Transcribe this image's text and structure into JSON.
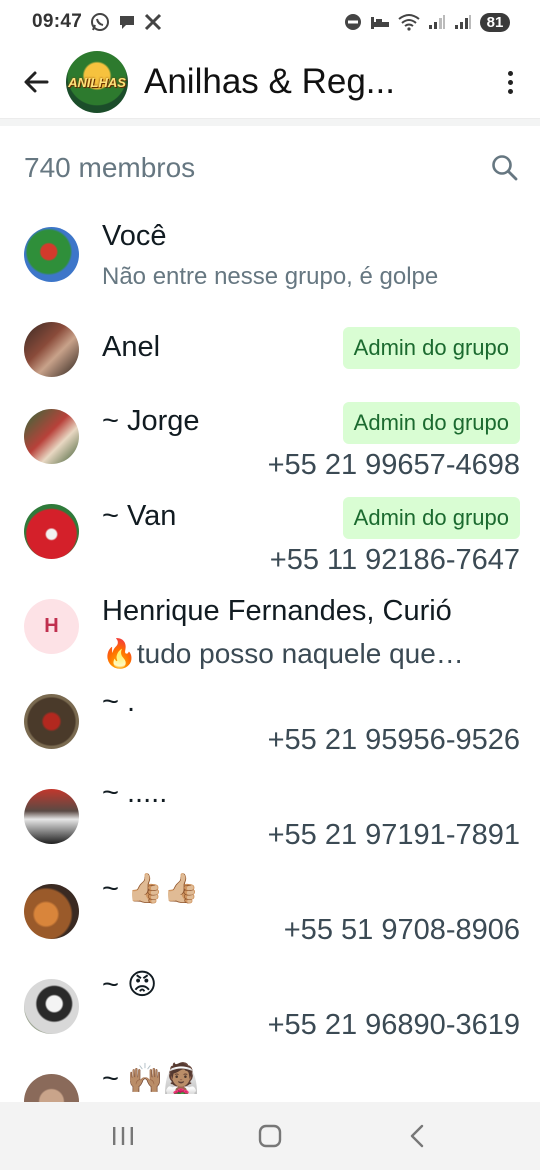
{
  "status_bar": {
    "time": "09:47",
    "battery": "81",
    "icons": [
      "whatsapp-icon",
      "chat-icon",
      "x-icon",
      "do-not-disturb-icon",
      "sleep-icon",
      "wifi-icon",
      "signal-icon",
      "signal-icon"
    ]
  },
  "header": {
    "title": "Anilhas & Reg...",
    "avatar_text": "ANILHAS",
    "icons": {
      "back": "arrow-back-icon",
      "menu": "more-vert-icon"
    }
  },
  "members": {
    "count_label": "740 membros",
    "search_icon": "search-icon",
    "admin_label": "Admin do grupo",
    "list": [
      {
        "name": "Você",
        "sub": "Não entre nesse grupo, é golpe",
        "phone": "",
        "admin": false
      },
      {
        "name": "Anel",
        "sub": "",
        "phone": "",
        "admin": true
      },
      {
        "name": "~ Jorge",
        "sub": "",
        "phone": "+55 21 99657-4698",
        "admin": true
      },
      {
        "name": "~ Van",
        "sub": "",
        "phone": "+55 11 92186-7647",
        "admin": true
      },
      {
        "name": "Henrique Fernandes, Curió",
        "sub": "🔥tudo posso naquele que…",
        "phone": "",
        "admin": false,
        "initial": "H"
      },
      {
        "name": "~ .",
        "sub": "",
        "phone": "+55 21 95956-9526",
        "admin": false
      },
      {
        "name": "~ .....",
        "sub": "",
        "phone": "+55 21 97191-7891",
        "admin": false
      },
      {
        "name": "~ 👍🏼👍🏼",
        "sub": "",
        "phone": "+55 51 9708-8906",
        "admin": false
      },
      {
        "name": "~ 😡",
        "sub": "",
        "phone": "+55 21 96890-3619",
        "admin": false
      },
      {
        "name": "~ 🙌🏽👰🏽",
        "sub": "",
        "phone": "",
        "admin": false
      }
    ]
  },
  "colors": {
    "admin_badge_bg": "#d9fdd3",
    "admin_badge_text": "#1b6a2f",
    "secondary_text": "#667781"
  },
  "nav_bar": {
    "icons": [
      "recent-apps-icon",
      "home-icon",
      "back-icon"
    ]
  }
}
